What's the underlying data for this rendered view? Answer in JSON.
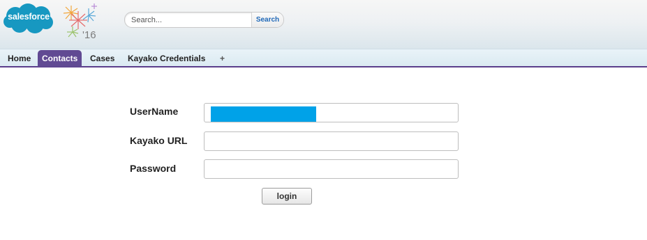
{
  "header": {
    "logo_text": "salesforce",
    "release_badge": "'16",
    "search": {
      "placeholder": "Search...",
      "value": "",
      "button_label": "Search"
    }
  },
  "tabs": [
    {
      "label": "Home",
      "active": false
    },
    {
      "label": "Contacts",
      "active": true
    },
    {
      "label": "Cases",
      "active": false
    },
    {
      "label": "Kayako Credentials",
      "active": false
    },
    {
      "label": "+",
      "active": false
    }
  ],
  "form": {
    "username_label": "UserName",
    "username_value": "",
    "kayako_url_label": "Kayako URL",
    "kayako_url_value": "",
    "password_label": "Password",
    "password_value": "",
    "login_label": "login"
  },
  "colors": {
    "brand_blue": "#1798c1",
    "tab_active": "#614a93",
    "redaction": "#00a2e8"
  }
}
